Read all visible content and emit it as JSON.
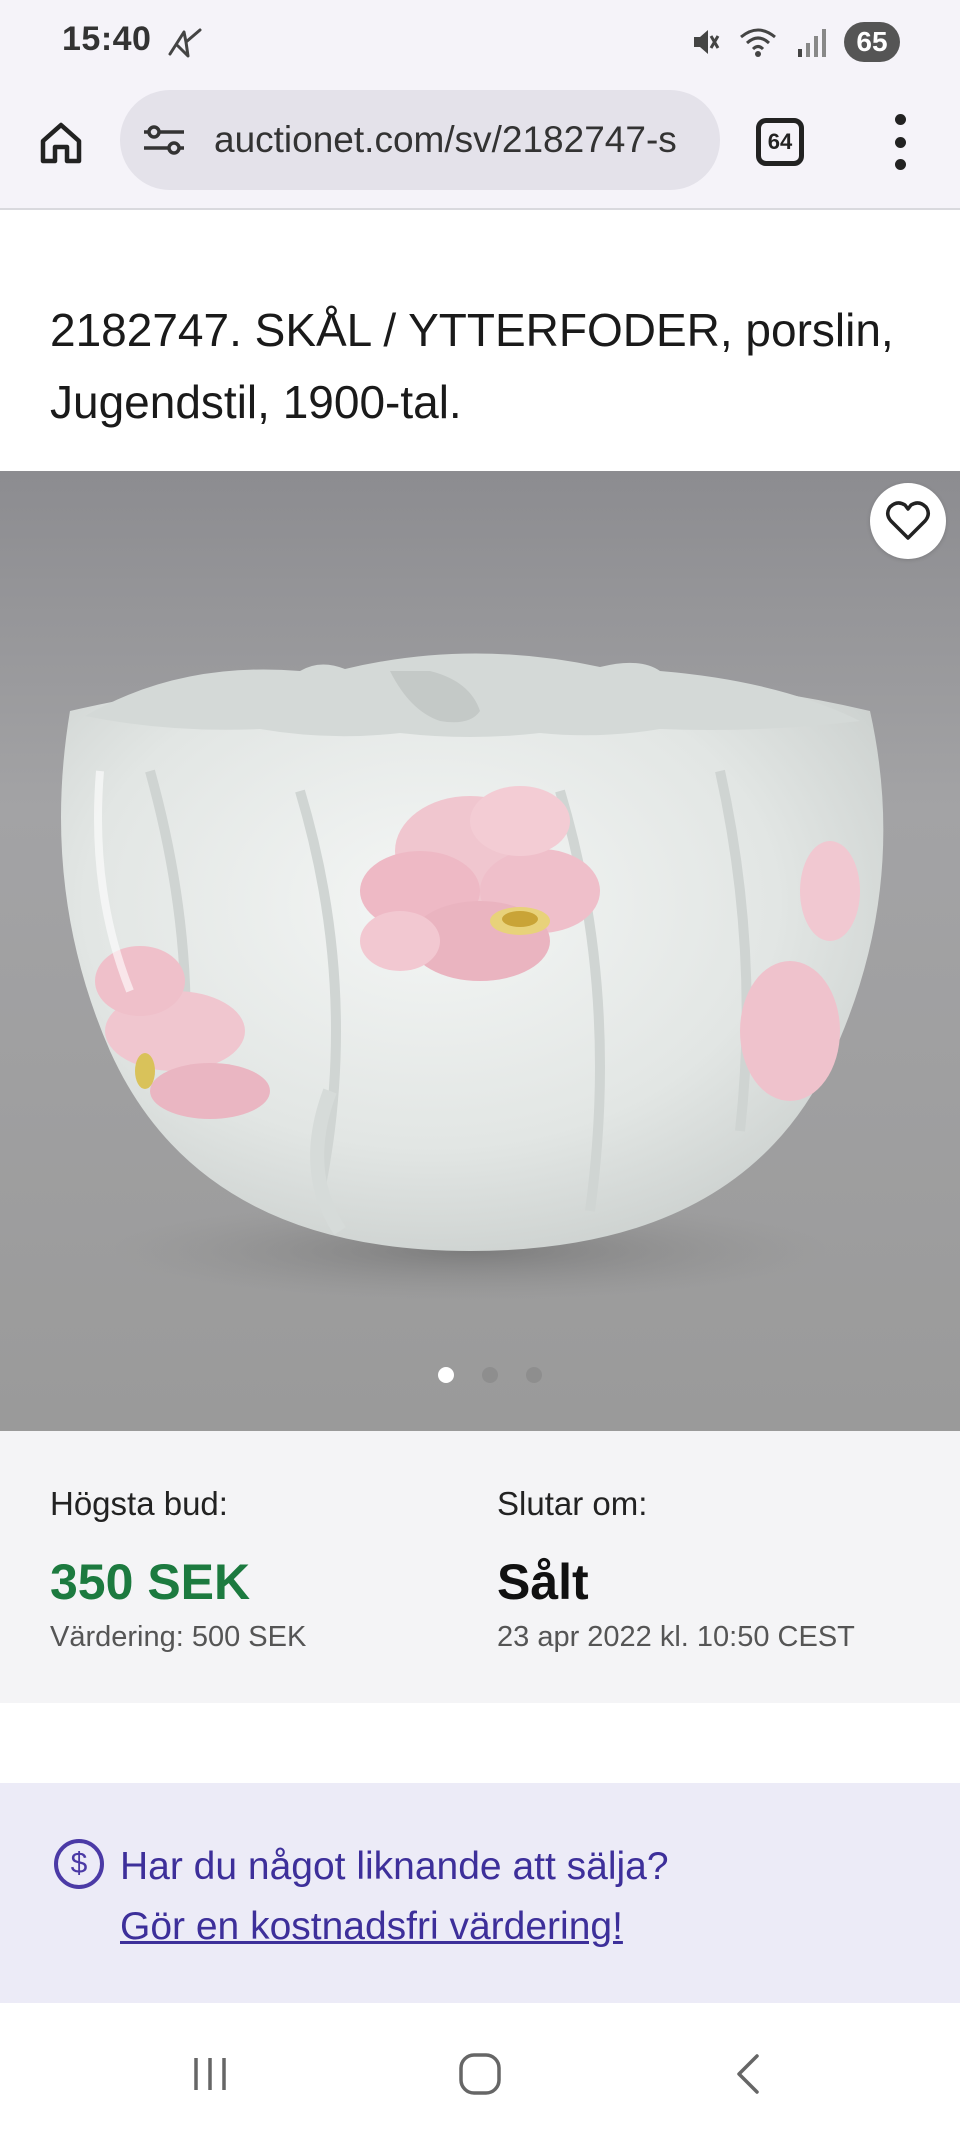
{
  "status_bar": {
    "time": "15:40",
    "battery": "65",
    "icons": [
      "notification-icon",
      "mute-icon",
      "wifi-icon",
      "signal-icon"
    ]
  },
  "browser": {
    "url": "auctionet.com/sv/2182747-s",
    "tab_count": "64",
    "icons": [
      "home-icon",
      "tune-icon",
      "tabs-icon",
      "more-menu-icon"
    ]
  },
  "lot": {
    "title": "2182747. SKÅL / YTTERFODER, porslin, Jugendstil, 1900-tal."
  },
  "gallery": {
    "image_count": 3,
    "active_index": 0,
    "favorite_icon": "heart-icon"
  },
  "bid": {
    "highest_label": "Högsta bud:",
    "highest_value": "350 SEK",
    "estimate": "Värdering: 500 SEK",
    "ends_label": "Slutar om:",
    "ends_value": "Sålt",
    "ends_date": "23 apr 2022 kl. 10:50 CEST"
  },
  "sell": {
    "question": "Har du något liknande att sälja?",
    "link": "Gör en kostnadsfri värdering!",
    "icon": "dollar-circle-icon"
  },
  "nav": {
    "icons": [
      "recents-icon",
      "home-nav-icon",
      "back-icon"
    ]
  },
  "colors": {
    "price_green": "#1c7a3f",
    "link_purple": "#3d2f9a",
    "banner_bg": "#ecebf7"
  }
}
